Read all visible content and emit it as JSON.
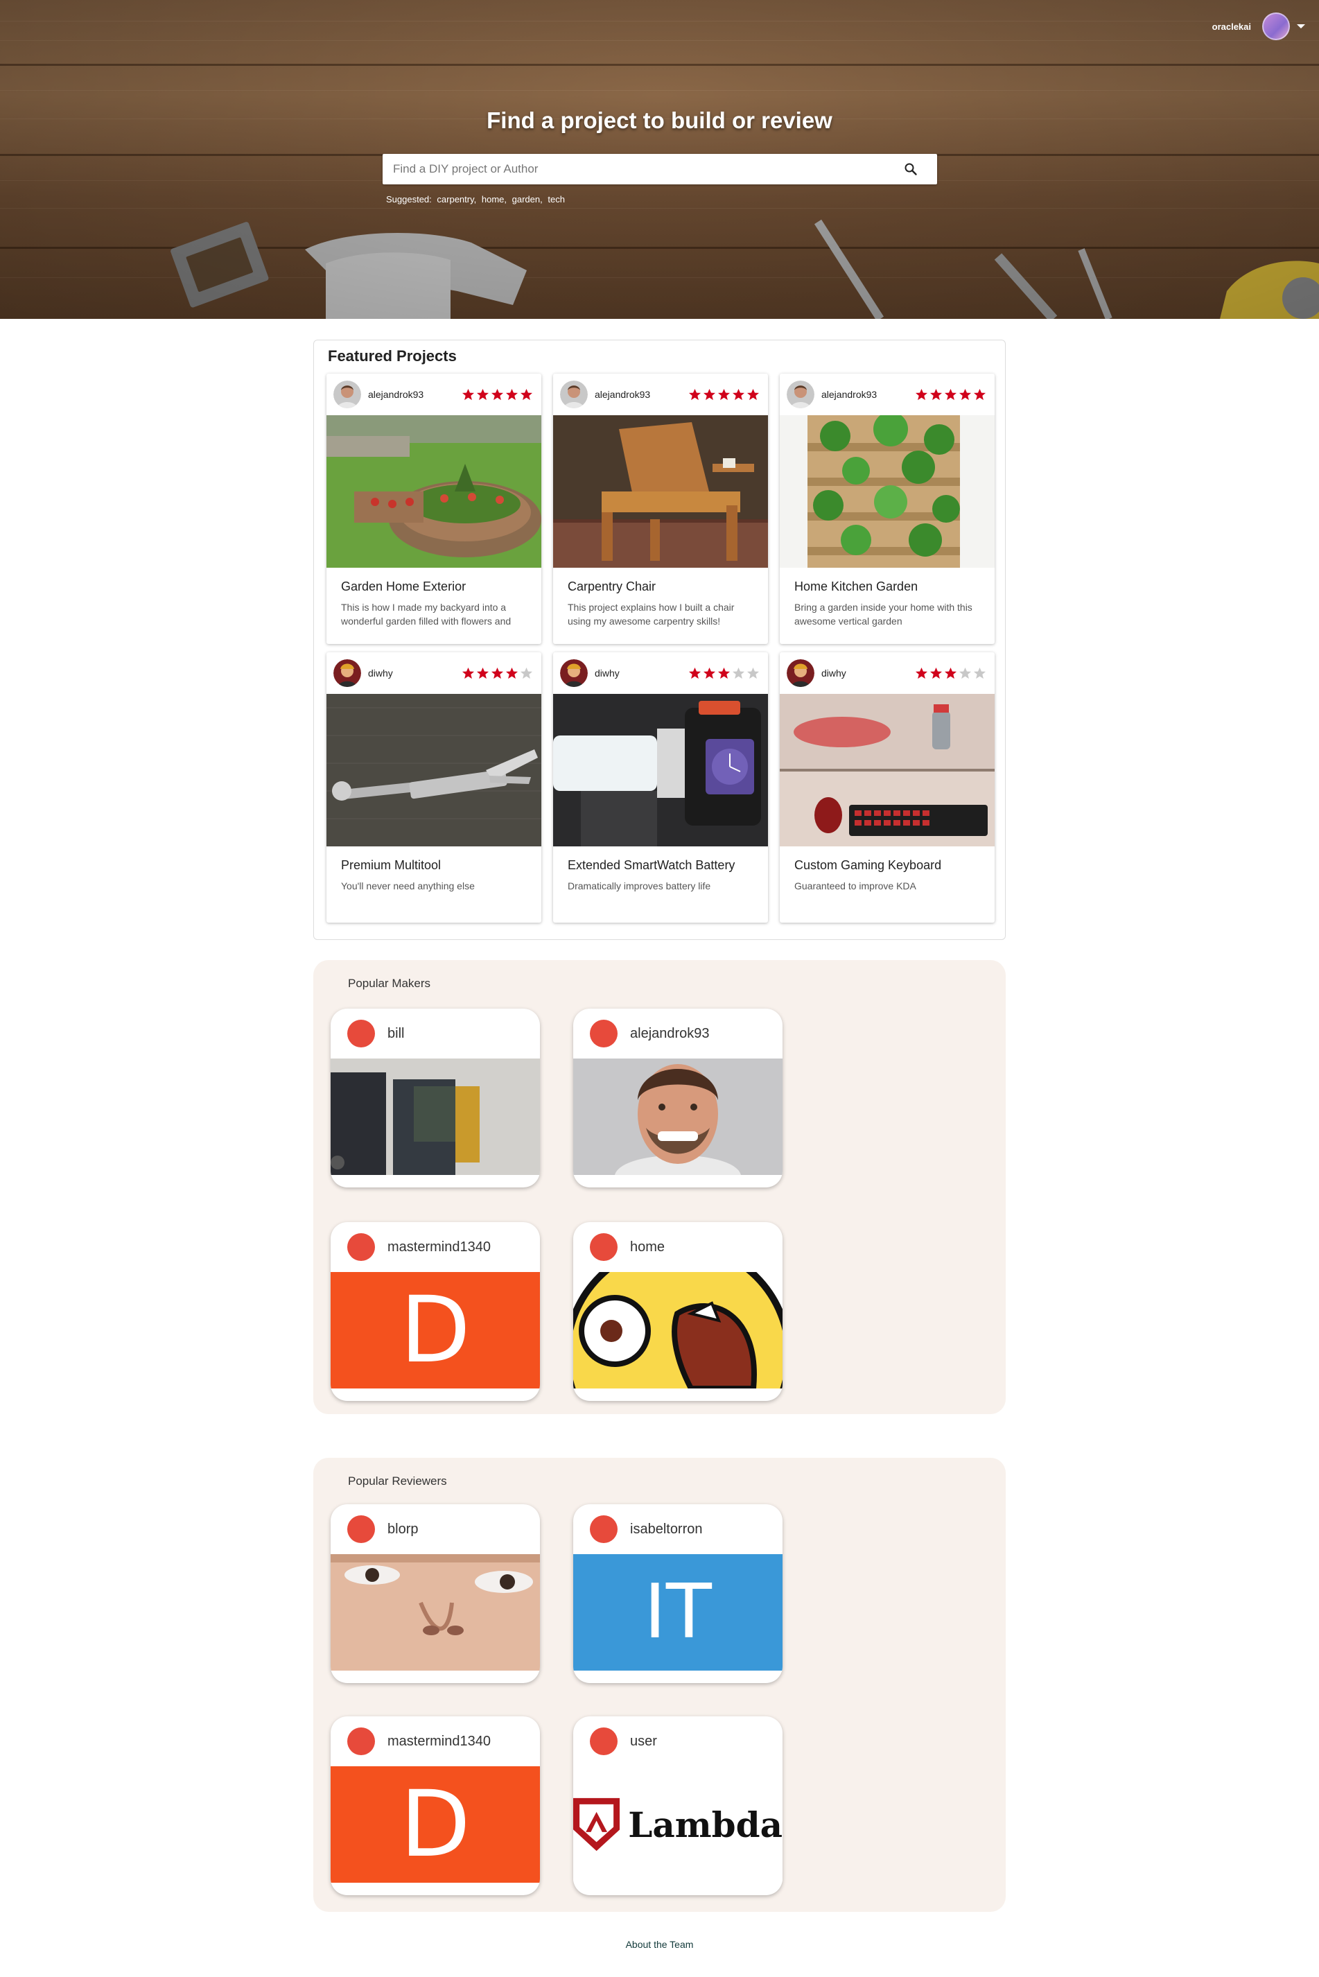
{
  "header": {
    "username": "oraclekai",
    "title": "Find a project to build or review",
    "search_placeholder": "Find a DIY project or Author",
    "suggested_label": "Suggested:",
    "suggested_tags": [
      "carpentry,",
      "home,",
      "garden,",
      "tech"
    ]
  },
  "featured": {
    "heading": "Featured Projects",
    "projects": [
      {
        "author": "alejandrok93",
        "rating": 5,
        "title": "Garden Home Exterior",
        "description": "This is how I made my backyard into a wonderful garden filled with flowers and plants"
      },
      {
        "author": "alejandrok93",
        "rating": 5,
        "title": "Carpentry Chair",
        "description": "This project explains how I built a chair using my awesome carpentry skills!"
      },
      {
        "author": "alejandrok93",
        "rating": 5,
        "title": "Home Kitchen Garden",
        "description": "Bring a garden inside your home with this awesome vertical garden"
      },
      {
        "author": "diwhy",
        "rating": 4,
        "title": "Premium Multitool",
        "description": "You'll never need anything else"
      },
      {
        "author": "diwhy",
        "rating": 3,
        "title": "Extended SmartWatch Battery",
        "description": "Dramatically improves battery life"
      },
      {
        "author": "diwhy",
        "rating": 3,
        "title": "Custom Gaming Keyboard",
        "description": "Guaranteed to improve KDA"
      }
    ]
  },
  "makers": {
    "heading": "Popular Makers",
    "items": [
      {
        "name": "bill"
      },
      {
        "name": "alejandrok93"
      },
      {
        "name": "mastermind1340",
        "letter": "D"
      },
      {
        "name": "home"
      }
    ]
  },
  "reviewers": {
    "heading": "Popular Reviewers",
    "items": [
      {
        "name": "blorp"
      },
      {
        "name": "isabeltorron",
        "letter": "IT"
      },
      {
        "name": "mastermind1340",
        "letter": "D"
      },
      {
        "name": "user",
        "logo_text": "Lambda"
      }
    ]
  },
  "footer": {
    "about": "About the Team"
  },
  "colors": {
    "star": "#d0021b",
    "star_empty": "#c8c8c8",
    "dot": "#e74a3b",
    "section_bg": "#f8f1ec",
    "orange_tile": "#f4511e",
    "blue_tile": "#3a98d8"
  }
}
